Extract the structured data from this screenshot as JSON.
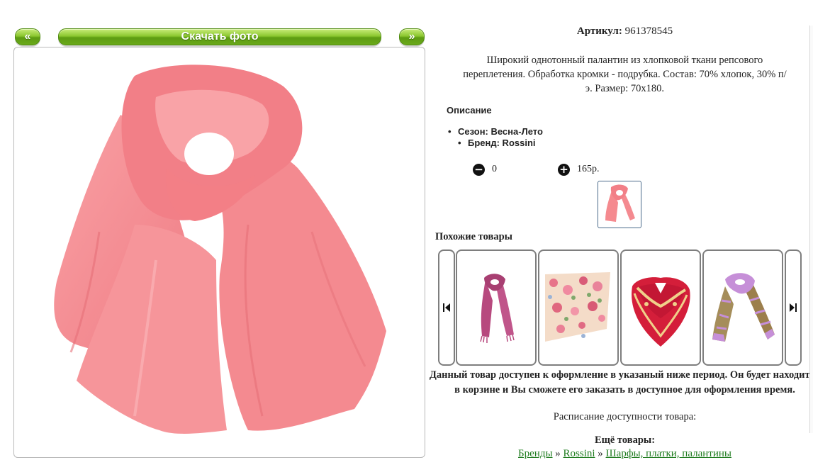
{
  "nav": {
    "prev_label": "«",
    "download_label": "Скачать фото",
    "next_label": "»"
  },
  "product": {
    "articul_label": "Артикул:",
    "articul_value": "961378545",
    "description": "Широкий однотонный палантин из хлопковой ткани репсового переплетения. Обработка кромки - подрубка. Состав: 70% хлопок, 30% п/э. Размер: 70х180.",
    "section_title": "Описание",
    "properties": [
      "Сезон: Весна-Лето",
      "Бренд: Rossini"
    ],
    "quantity": "0",
    "price": "165р.",
    "colors": {
      "accent_green": "#6aa91a",
      "scarf_pink": "#f58a8f",
      "link_green": "#1e7b1e"
    }
  },
  "similar": {
    "title": "Похожие товары",
    "items": [
      "pink-scarf",
      "floral-shawl",
      "red-paisley-shawl",
      "purple-paisley-scarf"
    ]
  },
  "availability": {
    "notice": "Данный товар доступен к оформление в указаный ниже период. Он будет находится в корзине и Вы сможете его заказать в доступное для оформления время.",
    "schedule_label": "Расписание доступности товара:"
  },
  "more": {
    "title": "Ещё товары:",
    "breadcrumbs": [
      "Бренды",
      "Rossini",
      "Шарфы, платки, палантины"
    ],
    "separator": "»"
  }
}
